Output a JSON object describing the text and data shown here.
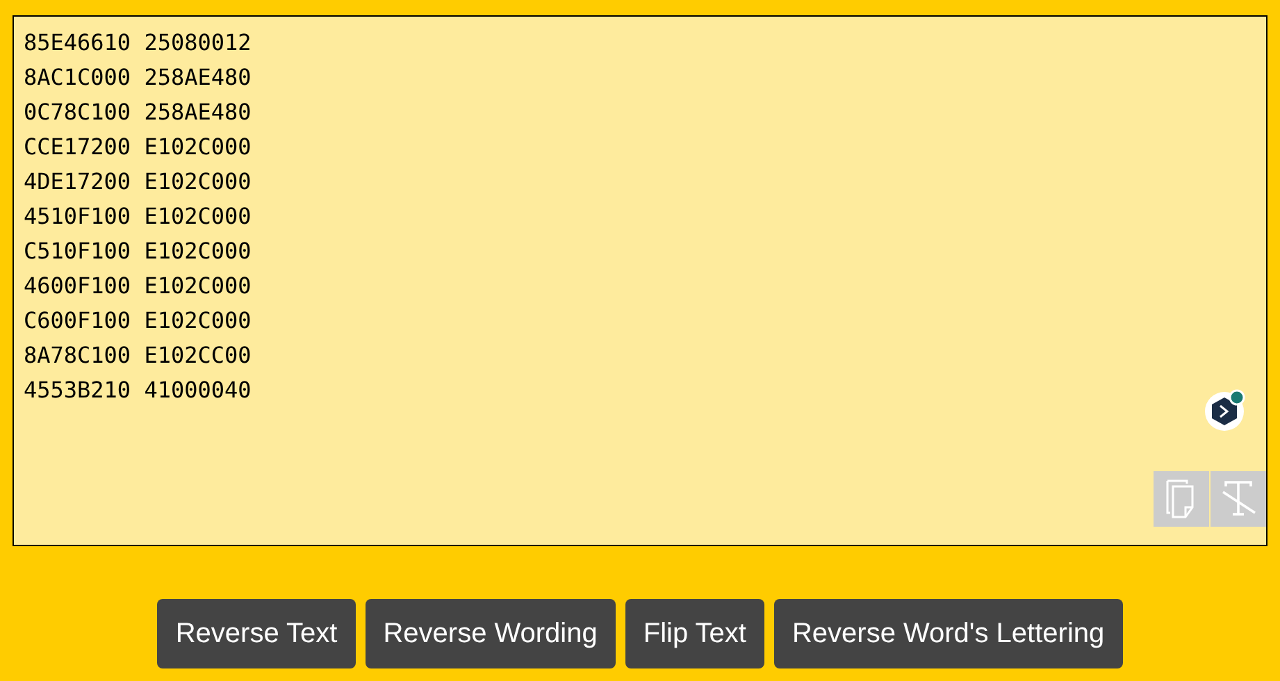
{
  "editor": {
    "lines": [
      "85E46610 25080012",
      "8AC1C000 258AE480",
      "0C78C100 258AE480",
      "CCE17200 E102C000",
      "4DE17200 E102C000",
      "4510F100 E102C000",
      "C510F100 E102C000",
      "4600F100 E102C000",
      "C600F100 E102C000",
      "8A78C100 E102CC00",
      "4553B210 41000040"
    ]
  },
  "buttons": [
    "Reverse Text",
    "Reverse Wording",
    "Flip Text",
    "Reverse Word's Lettering"
  ]
}
